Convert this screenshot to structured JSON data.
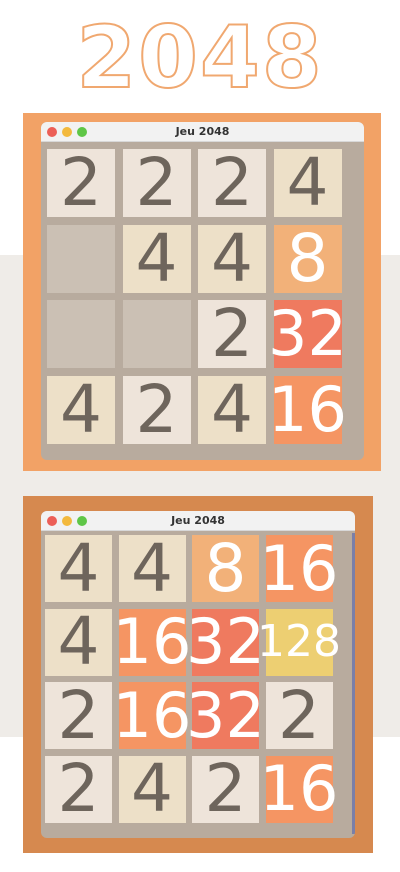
{
  "title": "2048",
  "colors": {
    "empty": "#cbc0b4",
    "2": "#eee4da",
    "4": "#ede0c8",
    "8": "#f2b179",
    "16": "#f59563",
    "32": "#ef7a5f",
    "128": "#edcf72",
    "dark_text": "#6e655c",
    "light_text": "#ffffff"
  },
  "games": [
    {
      "window_title": "Jeu 2048",
      "board": [
        [
          "2",
          "2",
          "2",
          "4"
        ],
        [
          "",
          "4",
          "4",
          "8"
        ],
        [
          "",
          "",
          "2",
          "32"
        ],
        [
          "4",
          "2",
          "4",
          "16"
        ]
      ]
    },
    {
      "window_title": "Jeu 2048",
      "board": [
        [
          "4",
          "4",
          "8",
          "16"
        ],
        [
          "4",
          "16",
          "32",
          "128"
        ],
        [
          "2",
          "16",
          "32",
          "2"
        ],
        [
          "2",
          "4",
          "2",
          "16"
        ]
      ]
    }
  ]
}
